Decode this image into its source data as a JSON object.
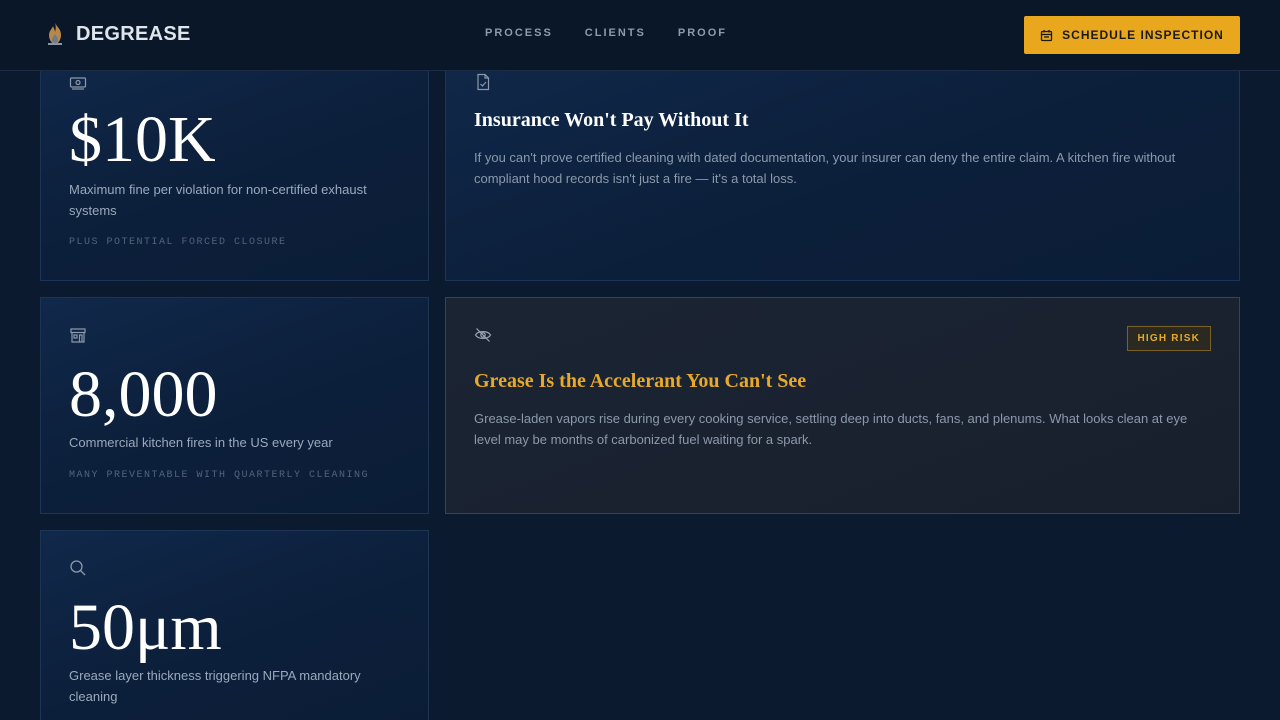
{
  "brand": {
    "name": "DEGREASE",
    "icon": "flame-icon"
  },
  "nav": {
    "items": [
      "PROCESS",
      "CLIENTS",
      "PROOF"
    ]
  },
  "cta": {
    "label": "SCHEDULE INSPECTION",
    "icon": "calendar-icon"
  },
  "stats": [
    {
      "icon": "banknote-icon",
      "value": "$10K",
      "description": "Maximum fine per violation for non-certified exhaust systems",
      "note": "PLUS POTENTIAL FORCED CLOSURE"
    },
    {
      "icon": "storefront-icon",
      "value": "8,000",
      "description": "Commercial kitchen fires in the US every year",
      "note": "MANY PREVENTABLE WITH QUARTERLY CLEANING"
    },
    {
      "icon": "search-icon",
      "value": "50μm",
      "description": "Grease layer thickness triggering NFPA mandatory cleaning",
      "note": ""
    }
  ],
  "info_cards": [
    {
      "icon": "file-check-icon",
      "title": "Insurance Won't Pay Without It",
      "body": "If you can't prove certified cleaning with dated documentation, your insurer can deny the entire claim. A kitchen fire without compliant hood records isn't just a fire — it's a total loss."
    },
    {
      "icon": "eye-off-icon",
      "title": "Grease Is the Accelerant You Can't See",
      "body": "Grease-laden vapors rise during every cooking service, settling deep into ducts, fans, and plenums. What looks clean at eye level may be months of carbonized fuel waiting for a spark.",
      "badge": "HIGH RISK"
    }
  ],
  "colors": {
    "accent": "#e8a71c",
    "background": "#0b1a2f",
    "card": "#10284a",
    "risk_card": "#1b2433"
  }
}
